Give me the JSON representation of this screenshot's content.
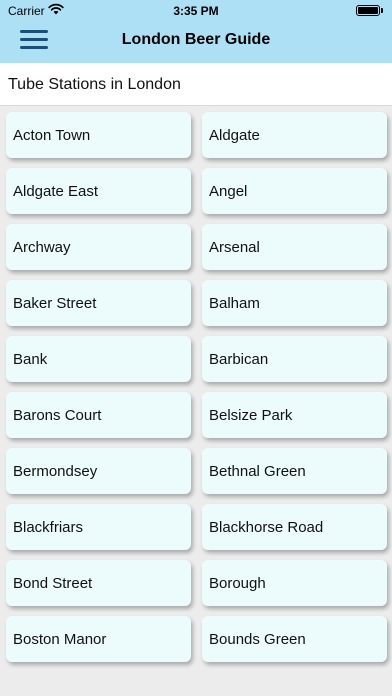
{
  "status_bar": {
    "carrier": "Carrier",
    "time": "3:35 PM"
  },
  "nav": {
    "title": "London Beer Guide",
    "menu_icon": "hamburger-menu-icon"
  },
  "subheader": {
    "title": "Tube Stations in London"
  },
  "colors": {
    "nav_background": "#aee0f5",
    "menu_icon": "#1c4f74",
    "cell_background": "#ecfcfc",
    "page_background": "#ececec"
  },
  "stations": [
    "Acton Town",
    "Aldgate",
    "Aldgate East",
    "Angel",
    "Archway",
    "Arsenal",
    "Baker Street",
    "Balham",
    "Bank",
    "Barbican",
    "Barons Court",
    "Belsize Park",
    "Bermondsey",
    "Bethnal Green",
    "Blackfriars",
    "Blackhorse Road",
    "Bond Street",
    "Borough",
    "Boston Manor",
    "Bounds Green"
  ]
}
